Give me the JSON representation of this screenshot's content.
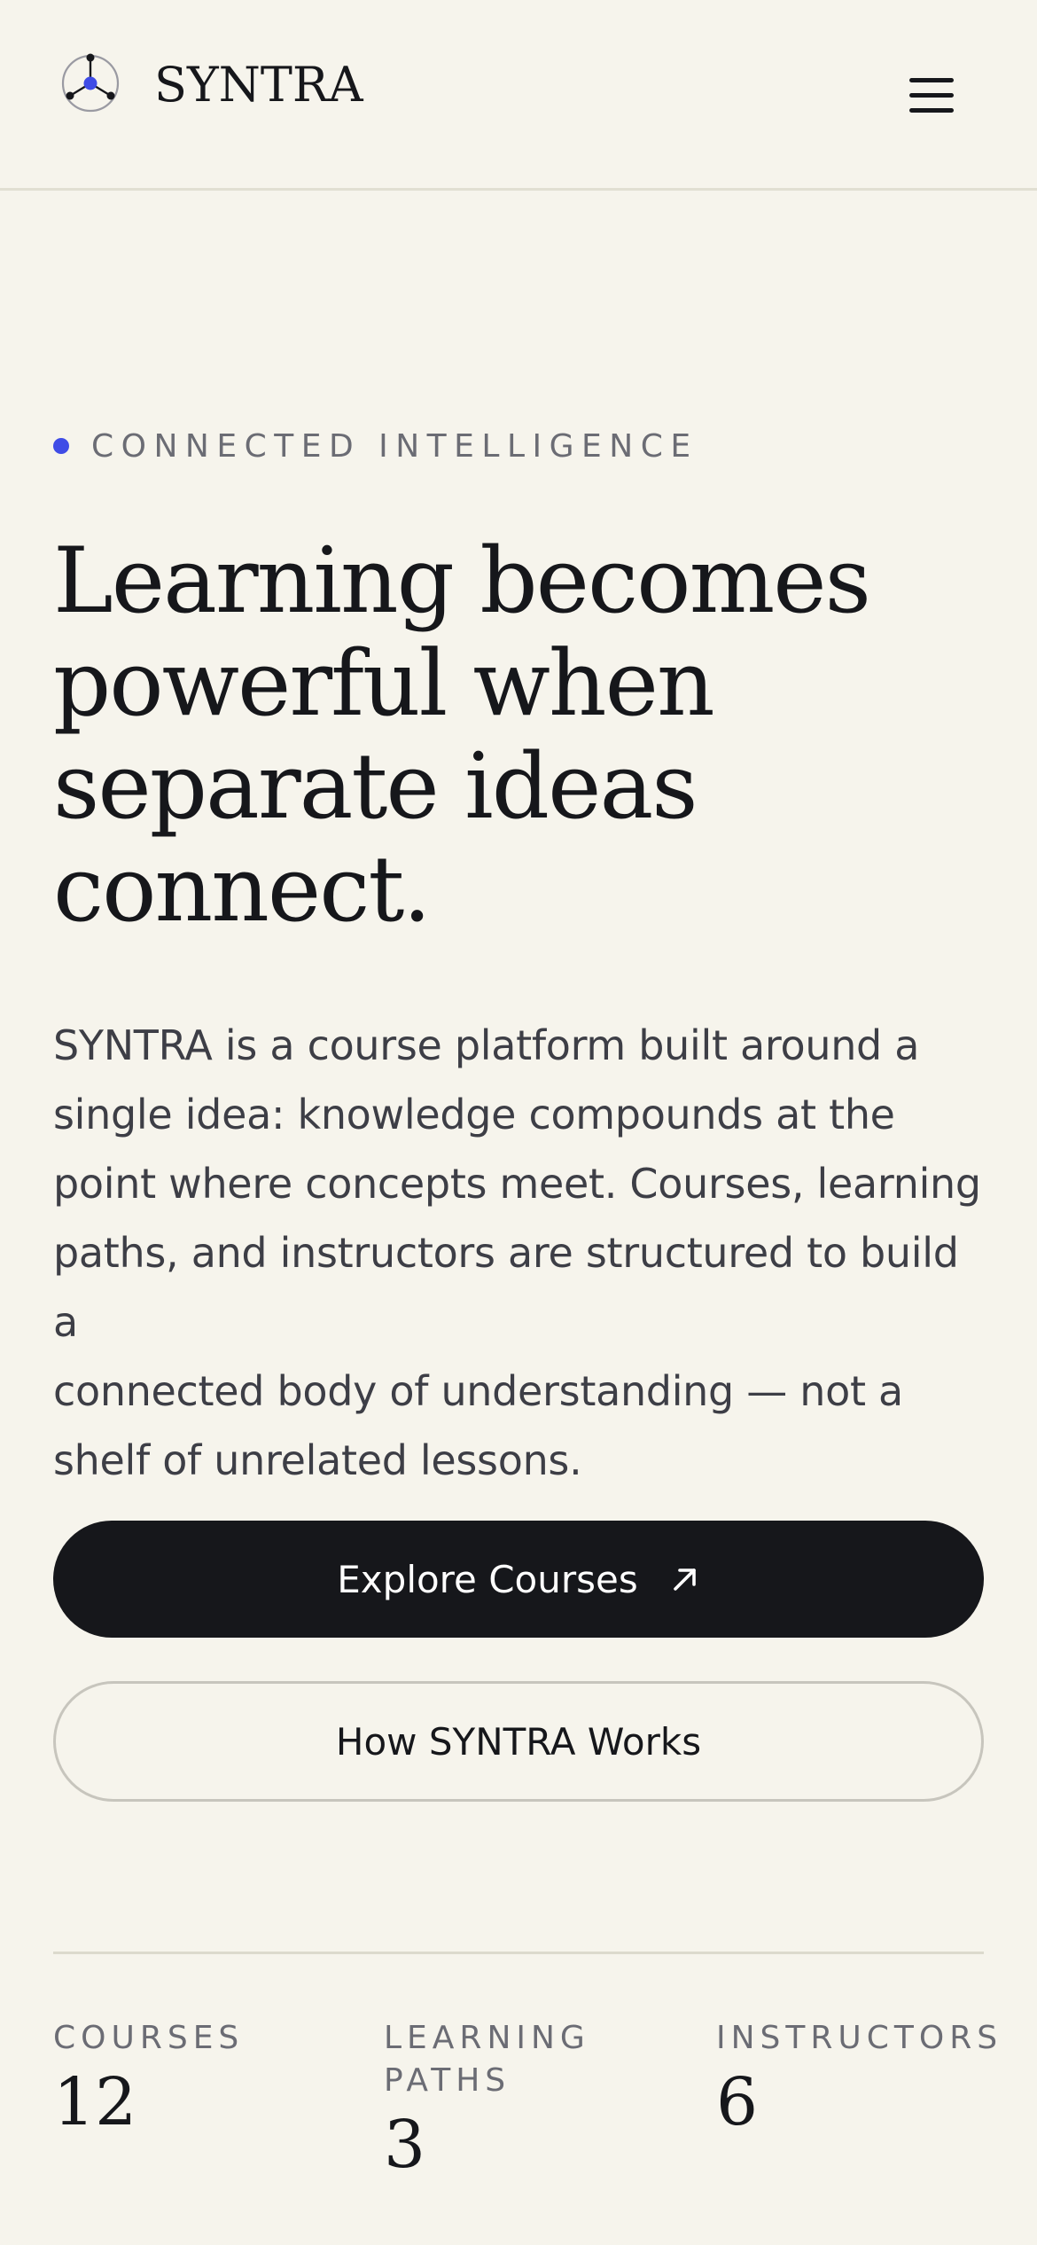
{
  "header": {
    "brand": "SYNTRA",
    "logo_icon": "network-node-icon",
    "menu_icon": "hamburger-menu-icon"
  },
  "hero": {
    "eyebrow": "CONNECTED INTELLIGENCE",
    "headline_lines": [
      "Learning becomes",
      "powerful when",
      "separate ideas",
      "connect."
    ],
    "intro_lines": [
      "SYNTRA is a course platform built around a",
      "single idea: knowledge compounds at the",
      "point where concepts meet. Courses, learning",
      "paths, and instructors are structured to build a",
      "connected body of understanding — not a",
      "shelf of unrelated lessons."
    ],
    "primary_cta": "Explore Courses",
    "secondary_cta": "How SYNTRA Works"
  },
  "stats": [
    {
      "label_lines": [
        "COURSES"
      ],
      "value": "12"
    },
    {
      "label_lines": [
        "LEARNING",
        "PATHS"
      ],
      "value": "3"
    },
    {
      "label_lines": [
        "INSTRUCTORS"
      ],
      "value": "6"
    }
  ],
  "colors": {
    "background": "#f6f4ec",
    "ink": "#16171b",
    "accent": "#3f4ce6",
    "muted": "#6b6c74"
  }
}
